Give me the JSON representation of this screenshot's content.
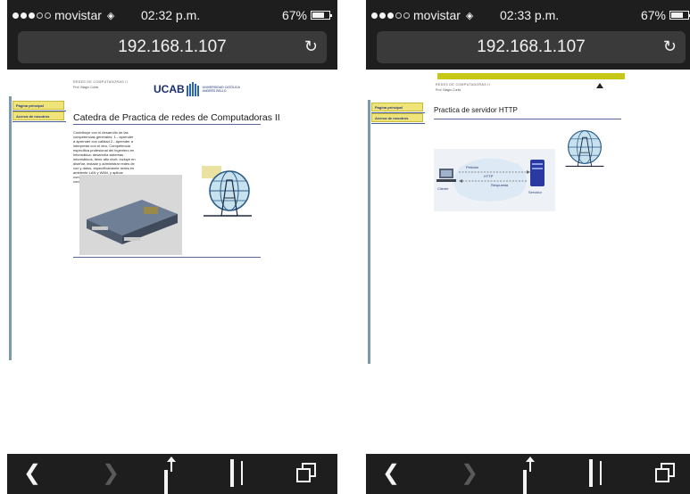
{
  "colors": {
    "browser_chrome": "#1e1e1e",
    "url_bar": "#3a3a3a",
    "nav_yellow": "#efe47a",
    "header_band": "#c7c816",
    "ucab_blue": "#1a2f6e"
  },
  "left": {
    "status": {
      "carrier": "movistar",
      "time": "02:32 p.m.",
      "battery": "67%"
    },
    "url": "192.168.1.107",
    "nav": {
      "home": "Página principal",
      "about": "Acerca de nosotros"
    },
    "header": {
      "course": "REDES DE COMPUTADORAS II",
      "professor": "Prof. Biagio Curtis",
      "logo_text": "UCAB",
      "logo_sub1": "UNIVERSIDAD CATÓLICA",
      "logo_sub2": "ANDRÉS BELLO"
    },
    "page_title": "Catedra de Practica de redes de Computadoras II",
    "intro": "Contribuye con el desarrollo de las competencias generales: 1.- aprender a aprender con calidad 2.- aprender a interpretar con el otro. Competencia específica profesional del ingeniero en informática: desarrolla sistemas informáticos, tiene alto nivel: incluye en diseñar, instalar y administrar redes de voz y datos, específicamente redes en ambiente LAN y WAN, y aplicar conceptos necesarios para la configuración de los routers y switch.",
    "toolbar": {
      "back_icon": "chevron-left-icon",
      "forward_icon": "chevron-right-icon"
    }
  },
  "right": {
    "status": {
      "carrier": "movistar",
      "time": "02:33 p.m.",
      "battery": "67%"
    },
    "url": "192.168.1.107",
    "nav": {
      "home": "Página principal",
      "about": "Acerca de nosotros"
    },
    "header": {
      "course": "REDES DE COMPUTADORAS II",
      "professor": "Prof. Biagio Curtis"
    },
    "page_title": "Practica de servidor HTTP",
    "diagram": {
      "request": "Petición",
      "protocol": "HTTP",
      "response": "Respuesta",
      "client": "Cliente",
      "server": "Servidor"
    }
  }
}
